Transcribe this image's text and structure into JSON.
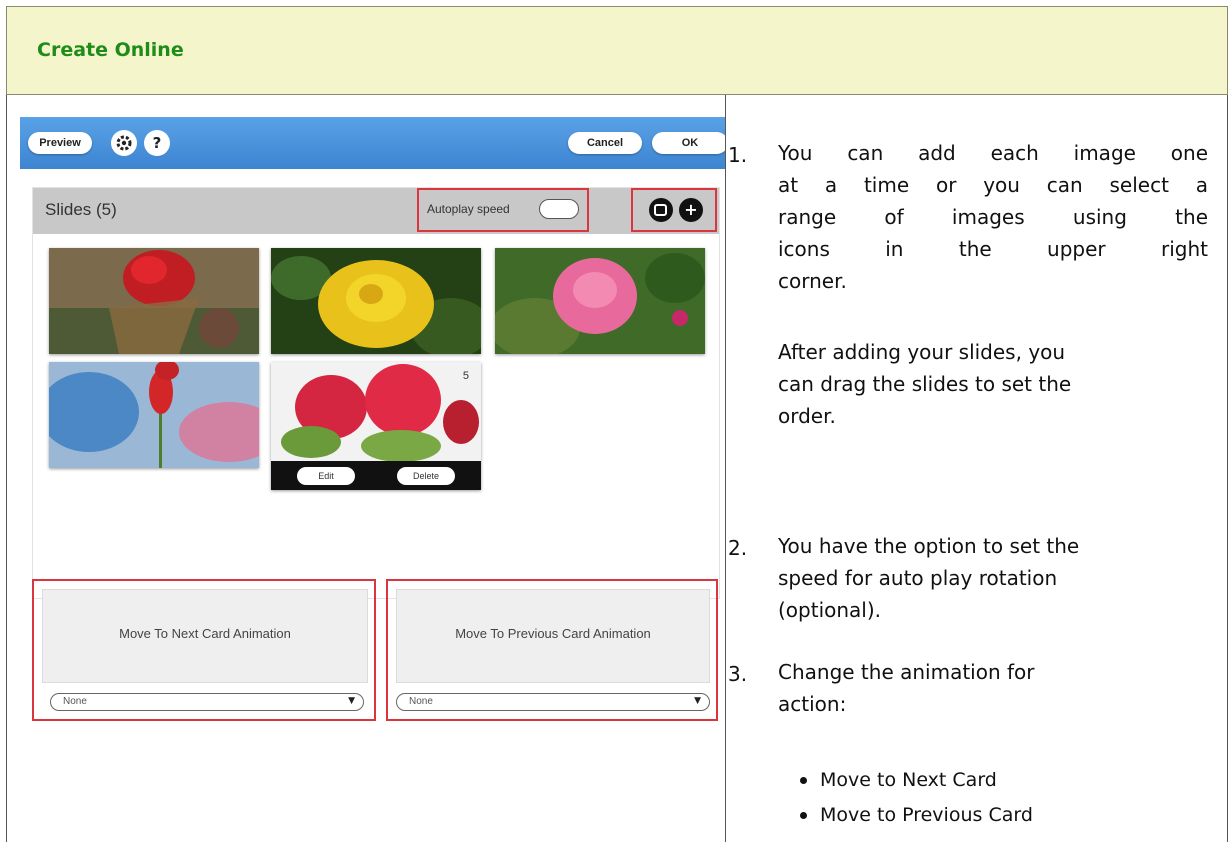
{
  "header": {
    "title": "Create Online"
  },
  "screenshot": {
    "toolbar": {
      "preview": "Preview",
      "settings_icon": "gear-icon",
      "help": "?",
      "cancel": "Cancel",
      "ok": "OK"
    },
    "slides": {
      "title": "Slides (5)",
      "autoplay_label": "Autoplay speed",
      "add_range_icon": "multi-add-icon",
      "add_icon": "plus-icon",
      "selected_slide_number": "5",
      "edit": "Edit",
      "delete": "Delete"
    },
    "animations": [
      {
        "label": "Move To Next Card Animation",
        "value": "None"
      },
      {
        "label": "Move To Previous Card Animation",
        "value": "None"
      }
    ]
  },
  "instructions": {
    "step1": {
      "num": "1.",
      "lines": [
        "You can add each image one",
        "at a time or you can select a",
        "range of images using the",
        "icons in the upper right",
        "corner."
      ]
    },
    "step1b": {
      "lines": [
        "After adding your slides, you",
        "can drag the slides to set the",
        "order."
      ]
    },
    "step2": {
      "num": "2.",
      "lines": [
        "You have the option to set the",
        "speed for auto play rotation",
        "(optional)."
      ]
    },
    "step3": {
      "num": "3.",
      "lines": [
        "Change the animation for",
        "action:"
      ]
    },
    "bullets": [
      "Move to Next Card",
      "Move to Previous Card"
    ]
  },
  "colors": {
    "header_bg": "#f5f5cc",
    "header_title": "#1f8c1a",
    "toolbar": "#3d84d2",
    "highlight": "#d9363e"
  }
}
